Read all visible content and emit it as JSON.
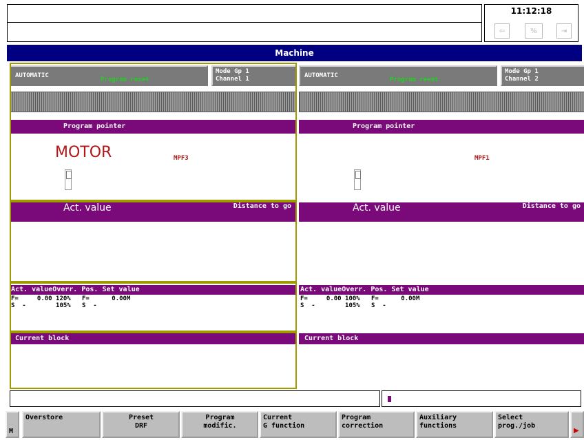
{
  "status": {
    "time": "11:12:18",
    "icons": [
      "recall-icon",
      "percent-icon",
      "exit-icon"
    ]
  },
  "window_title": "Machine",
  "channels": [
    {
      "mode": "AUTOMATIC",
      "state": "Program reset",
      "mode_group": "Mode Gp 1",
      "channel": "Channel 1",
      "pp_header": "Program pointer",
      "program_name": "MOTOR",
      "program_ext": "MPF3",
      "act_header": "Act. value",
      "dist_header": "Distance to go",
      "override_header": "Act. valueOverr. Pos.  Set value",
      "override_row_f": "F=     0.00 120%   F=      0.00M",
      "override_row_s": "S  -        105%   S  -",
      "block_header": "Current block"
    },
    {
      "mode": "AUTOMATIC",
      "state": "Program reset",
      "mode_group": "Mode Gp 1",
      "channel": "Channel 2",
      "pp_header": "Program pointer",
      "program_name": "",
      "program_ext": "MPF1",
      "act_header": "Act. value",
      "dist_header": "Distance to go",
      "override_header": "Act. valueOverr. Pos.  Set value",
      "override_row_f": "F=     0.00 100%   F=      0.00M",
      "override_row_s": "S  -        105%   S  -",
      "block_header": "Current block"
    }
  ],
  "softkeys": [
    {
      "line1": "Overstore",
      "line2": ""
    },
    {
      "line1": "Preset",
      "line2": "DRF"
    },
    {
      "line1": "Program",
      "line2": "modific."
    },
    {
      "line1": "Current",
      "line2": "G function"
    },
    {
      "line1": "Program",
      "line2": "correction"
    },
    {
      "line1": "Auxiliary",
      "line2": "functions"
    },
    {
      "line1": "Select",
      "line2": "prog./job"
    }
  ],
  "softkey_left_label": "M",
  "colors": {
    "title_bar": "#000080",
    "header_bar": "#7a0a7a",
    "program_text": "#b21818",
    "state_text": "#22d022",
    "frame": "#a09a00"
  }
}
